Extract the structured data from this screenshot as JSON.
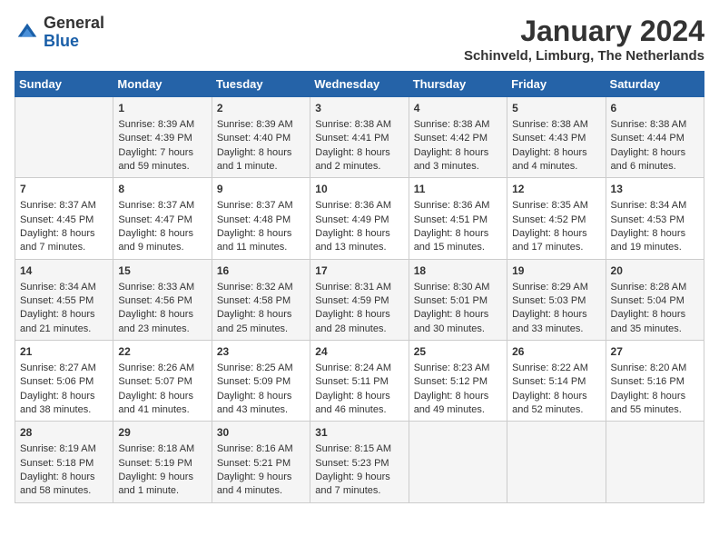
{
  "header": {
    "logo_general": "General",
    "logo_blue": "Blue",
    "month_title": "January 2024",
    "location": "Schinveld, Limburg, The Netherlands"
  },
  "days_of_week": [
    "Sunday",
    "Monday",
    "Tuesday",
    "Wednesday",
    "Thursday",
    "Friday",
    "Saturday"
  ],
  "weeks": [
    [
      {
        "day": "",
        "sunrise": "",
        "sunset": "",
        "daylight": ""
      },
      {
        "day": "1",
        "sunrise": "Sunrise: 8:39 AM",
        "sunset": "Sunset: 4:39 PM",
        "daylight": "Daylight: 7 hours and 59 minutes."
      },
      {
        "day": "2",
        "sunrise": "Sunrise: 8:39 AM",
        "sunset": "Sunset: 4:40 PM",
        "daylight": "Daylight: 8 hours and 1 minute."
      },
      {
        "day": "3",
        "sunrise": "Sunrise: 8:38 AM",
        "sunset": "Sunset: 4:41 PM",
        "daylight": "Daylight: 8 hours and 2 minutes."
      },
      {
        "day": "4",
        "sunrise": "Sunrise: 8:38 AM",
        "sunset": "Sunset: 4:42 PM",
        "daylight": "Daylight: 8 hours and 3 minutes."
      },
      {
        "day": "5",
        "sunrise": "Sunrise: 8:38 AM",
        "sunset": "Sunset: 4:43 PM",
        "daylight": "Daylight: 8 hours and 4 minutes."
      },
      {
        "day": "6",
        "sunrise": "Sunrise: 8:38 AM",
        "sunset": "Sunset: 4:44 PM",
        "daylight": "Daylight: 8 hours and 6 minutes."
      }
    ],
    [
      {
        "day": "7",
        "sunrise": "Sunrise: 8:37 AM",
        "sunset": "Sunset: 4:45 PM",
        "daylight": "Daylight: 8 hours and 7 minutes."
      },
      {
        "day": "8",
        "sunrise": "Sunrise: 8:37 AM",
        "sunset": "Sunset: 4:47 PM",
        "daylight": "Daylight: 8 hours and 9 minutes."
      },
      {
        "day": "9",
        "sunrise": "Sunrise: 8:37 AM",
        "sunset": "Sunset: 4:48 PM",
        "daylight": "Daylight: 8 hours and 11 minutes."
      },
      {
        "day": "10",
        "sunrise": "Sunrise: 8:36 AM",
        "sunset": "Sunset: 4:49 PM",
        "daylight": "Daylight: 8 hours and 13 minutes."
      },
      {
        "day": "11",
        "sunrise": "Sunrise: 8:36 AM",
        "sunset": "Sunset: 4:51 PM",
        "daylight": "Daylight: 8 hours and 15 minutes."
      },
      {
        "day": "12",
        "sunrise": "Sunrise: 8:35 AM",
        "sunset": "Sunset: 4:52 PM",
        "daylight": "Daylight: 8 hours and 17 minutes."
      },
      {
        "day": "13",
        "sunrise": "Sunrise: 8:34 AM",
        "sunset": "Sunset: 4:53 PM",
        "daylight": "Daylight: 8 hours and 19 minutes."
      }
    ],
    [
      {
        "day": "14",
        "sunrise": "Sunrise: 8:34 AM",
        "sunset": "Sunset: 4:55 PM",
        "daylight": "Daylight: 8 hours and 21 minutes."
      },
      {
        "day": "15",
        "sunrise": "Sunrise: 8:33 AM",
        "sunset": "Sunset: 4:56 PM",
        "daylight": "Daylight: 8 hours and 23 minutes."
      },
      {
        "day": "16",
        "sunrise": "Sunrise: 8:32 AM",
        "sunset": "Sunset: 4:58 PM",
        "daylight": "Daylight: 8 hours and 25 minutes."
      },
      {
        "day": "17",
        "sunrise": "Sunrise: 8:31 AM",
        "sunset": "Sunset: 4:59 PM",
        "daylight": "Daylight: 8 hours and 28 minutes."
      },
      {
        "day": "18",
        "sunrise": "Sunrise: 8:30 AM",
        "sunset": "Sunset: 5:01 PM",
        "daylight": "Daylight: 8 hours and 30 minutes."
      },
      {
        "day": "19",
        "sunrise": "Sunrise: 8:29 AM",
        "sunset": "Sunset: 5:03 PM",
        "daylight": "Daylight: 8 hours and 33 minutes."
      },
      {
        "day": "20",
        "sunrise": "Sunrise: 8:28 AM",
        "sunset": "Sunset: 5:04 PM",
        "daylight": "Daylight: 8 hours and 35 minutes."
      }
    ],
    [
      {
        "day": "21",
        "sunrise": "Sunrise: 8:27 AM",
        "sunset": "Sunset: 5:06 PM",
        "daylight": "Daylight: 8 hours and 38 minutes."
      },
      {
        "day": "22",
        "sunrise": "Sunrise: 8:26 AM",
        "sunset": "Sunset: 5:07 PM",
        "daylight": "Daylight: 8 hours and 41 minutes."
      },
      {
        "day": "23",
        "sunrise": "Sunrise: 8:25 AM",
        "sunset": "Sunset: 5:09 PM",
        "daylight": "Daylight: 8 hours and 43 minutes."
      },
      {
        "day": "24",
        "sunrise": "Sunrise: 8:24 AM",
        "sunset": "Sunset: 5:11 PM",
        "daylight": "Daylight: 8 hours and 46 minutes."
      },
      {
        "day": "25",
        "sunrise": "Sunrise: 8:23 AM",
        "sunset": "Sunset: 5:12 PM",
        "daylight": "Daylight: 8 hours and 49 minutes."
      },
      {
        "day": "26",
        "sunrise": "Sunrise: 8:22 AM",
        "sunset": "Sunset: 5:14 PM",
        "daylight": "Daylight: 8 hours and 52 minutes."
      },
      {
        "day": "27",
        "sunrise": "Sunrise: 8:20 AM",
        "sunset": "Sunset: 5:16 PM",
        "daylight": "Daylight: 8 hours and 55 minutes."
      }
    ],
    [
      {
        "day": "28",
        "sunrise": "Sunrise: 8:19 AM",
        "sunset": "Sunset: 5:18 PM",
        "daylight": "Daylight: 8 hours and 58 minutes."
      },
      {
        "day": "29",
        "sunrise": "Sunrise: 8:18 AM",
        "sunset": "Sunset: 5:19 PM",
        "daylight": "Daylight: 9 hours and 1 minute."
      },
      {
        "day": "30",
        "sunrise": "Sunrise: 8:16 AM",
        "sunset": "Sunset: 5:21 PM",
        "daylight": "Daylight: 9 hours and 4 minutes."
      },
      {
        "day": "31",
        "sunrise": "Sunrise: 8:15 AM",
        "sunset": "Sunset: 5:23 PM",
        "daylight": "Daylight: 9 hours and 7 minutes."
      },
      {
        "day": "",
        "sunrise": "",
        "sunset": "",
        "daylight": ""
      },
      {
        "day": "",
        "sunrise": "",
        "sunset": "",
        "daylight": ""
      },
      {
        "day": "",
        "sunrise": "",
        "sunset": "",
        "daylight": ""
      }
    ]
  ]
}
